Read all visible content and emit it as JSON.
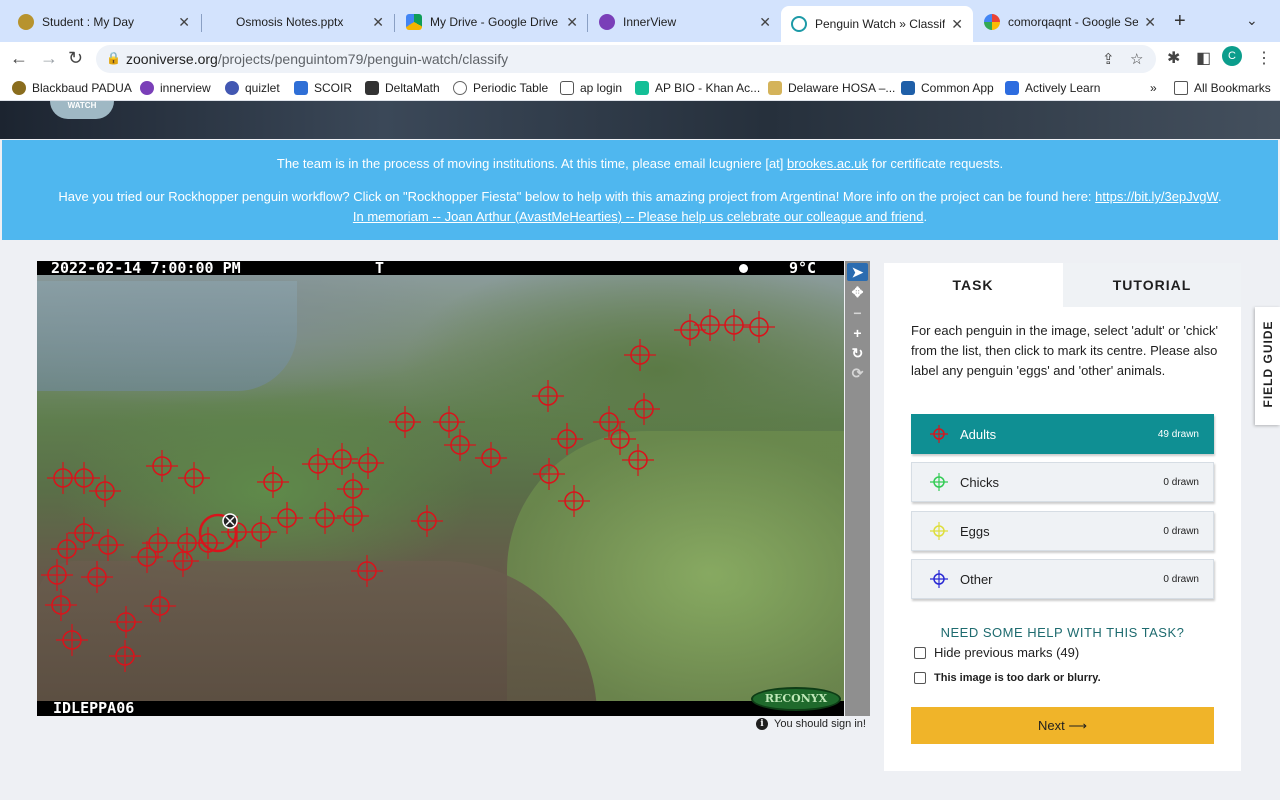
{
  "browser": {
    "tabs": [
      {
        "title": "Student : My Day",
        "color": "#b7932e"
      },
      {
        "title": "Osmosis Notes.pptx",
        "color": "#d3e3fd"
      },
      {
        "title": "My Drive - Google Drive",
        "color": "#f4b400"
      },
      {
        "title": "InnerView",
        "color": "#7a3fb8"
      },
      {
        "title": "Penguin Watch » Classify",
        "color": "#1d9aa7"
      },
      {
        "title": "comorqaqnt - Google Sea",
        "color": "#4285f4"
      }
    ],
    "url_host": "zooniverse.org",
    "url_path": "/projects/penguintom79/penguin-watch/classify",
    "profile_initial": "C",
    "bookmarks": [
      {
        "label": "Blackbaud PADUA",
        "color": "#8a6d1e"
      },
      {
        "label": "innerview",
        "color": "#7a3fb8"
      },
      {
        "label": "quizlet",
        "color": "#4257b2"
      },
      {
        "label": "SCOIR",
        "color": "#2f6fd6"
      },
      {
        "label": "DeltaMath",
        "color": "#333333"
      },
      {
        "label": "Periodic Table",
        "color": "#666666"
      },
      {
        "label": "ap login",
        "color": "#555555"
      },
      {
        "label": "AP BIO - Khan Ac...",
        "color": "#14bf96"
      },
      {
        "label": "Delaware HOSA –...",
        "color": "#d4b35a"
      },
      {
        "label": "Common App",
        "color": "#1f5fa8"
      },
      {
        "label": "Actively Learn",
        "color": "#2d6cdf"
      }
    ],
    "bookmarks_overflow": "»",
    "all_bookmarks": "All Bookmarks"
  },
  "site": {
    "logo_text": "WATCH"
  },
  "announcement": {
    "line1_prefix": "The team is in the process of moving institutions. At this time, please email lcugniere [at] ",
    "line1_link": "brookes.ac.uk",
    "line1_suffix": " for certificate requests.",
    "line2_prefix": "Have you tried our Rockhopper penguin workflow? Click on \"Rockhopper Fiesta\" below to help with this amazing project from Argentina! More info on the project can be found here: ",
    "line2_link": "https://bit.ly/3epJvgW",
    "line2_suffix": ".",
    "line3_link": "In memoriam -- Joan Arthur (AvastMeHearties) -- Please help us celebrate our colleague and friend",
    "line3_suffix": "."
  },
  "subject": {
    "timestamp": "2022-02-14 7:00:00 PM",
    "flag": "T",
    "temperature": "9°C",
    "camera_id": "IDLEPPA06",
    "brand": "RECONYX",
    "mark_color": "#d8141c"
  },
  "viewer_tools": [
    "pointer-icon",
    "move-icon",
    "zoom-out-icon",
    "zoom-in-icon",
    "rotate-icon",
    "reset-icon"
  ],
  "sign_in_notice": "You should sign in!",
  "panel": {
    "tab_task": "TASK",
    "tab_tutorial": "TUTORIAL",
    "instructions": "For each penguin in the image, select 'adult' or 'chick' from the list, then click to mark its centre. Please also label any penguin 'eggs' and 'other' animals.",
    "tools": [
      {
        "label": "Adults",
        "count": "49 drawn",
        "color": "#d8141c"
      },
      {
        "label": "Chicks",
        "count": "0 drawn",
        "color": "#33cc55"
      },
      {
        "label": "Eggs",
        "count": "0 drawn",
        "color": "#dede3c"
      },
      {
        "label": "Other",
        "count": "0 drawn",
        "color": "#2a2ad4"
      }
    ],
    "help_heading": "NEED SOME HELP WITH THIS TASK?",
    "hide_marks_label": "Hide previous marks (49)",
    "dark_label": "This image is too dark or blurry.",
    "next_label": "Next ⟶"
  },
  "field_guide": "FIELD GUIDE"
}
